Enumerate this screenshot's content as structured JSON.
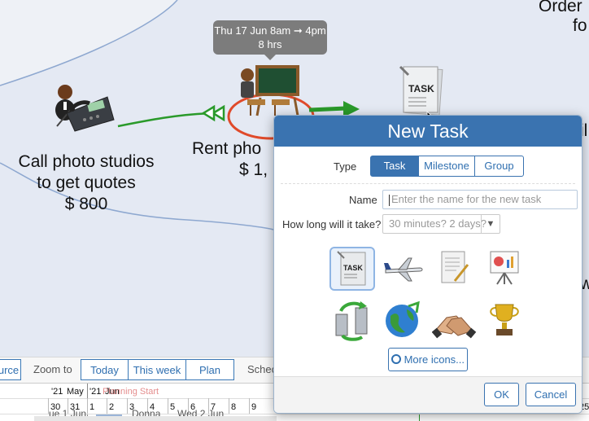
{
  "canvas": {
    "tooltip": {
      "line1": "Thu 17 Jun 8am ➞ 4pm",
      "line2": "8 hrs"
    },
    "nodes": [
      {
        "name": "call-photo-studios",
        "line1": "Call photo studios",
        "line2": "to get quotes",
        "line3": "$ 800"
      },
      {
        "name": "rent-photo",
        "line1": "Rent pho",
        "line2": "$ 1,"
      }
    ],
    "corner_top_right": {
      "line1": "Order",
      "line2": "fo"
    }
  },
  "toolbar": {
    "partial_left": "urce",
    "zoom_label": "Zoom to",
    "today": "Today",
    "this_week": "This week",
    "plan": "Plan",
    "partial_sched": "Schec"
  },
  "timeline": {
    "year_month_1": "'21",
    "month_1": "May",
    "year_month_2": "'21",
    "month_2": "Jun",
    "marker": "Planning Start",
    "days": [
      "30",
      "31",
      "1",
      "2",
      "3",
      "4",
      "5",
      "6",
      "7",
      "8",
      "9"
    ],
    "row3_a": "Donna",
    "row3_b": "Wed 2 Jun",
    "row3_left": "ue 1 Jun",
    "right_day": "25"
  },
  "dialog": {
    "title": "New Task",
    "type_label": "Type",
    "types": [
      "Task",
      "Milestone",
      "Group"
    ],
    "selected_type": "Task",
    "name_label": "Name",
    "name_placeholder": "Enter the name for the new task",
    "duration_label": "How long will it take?",
    "duration_placeholder": "30 minutes? 2 days?",
    "icons": [
      "task-icon",
      "airplane-icon",
      "document-sign-icon",
      "presentation-board-icon",
      "sync-server-icon",
      "globe-icon",
      "handshake-icon",
      "trophy-icon"
    ],
    "selected_icon": "task-icon",
    "more_icons": "More icons...",
    "ok": "OK",
    "cancel": "Cancel"
  },
  "right_edge": {
    "a": "il",
    "b": "w"
  },
  "colors": {
    "accent": "#3a73b0",
    "arrow": "#2a9a2a",
    "selection_ring": "#e04a2a"
  }
}
